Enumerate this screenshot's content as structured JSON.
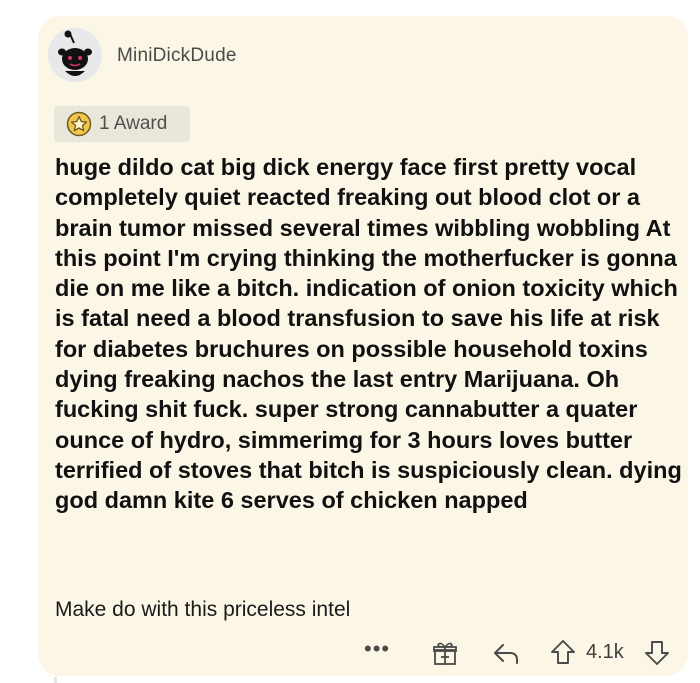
{
  "comment": {
    "username": "MiniDickDude",
    "award_label": "1 Award",
    "body": "huge dildo cat big dick energy face first pretty vocal completely quiet reacted freaking out blood clot or a brain tumor missed several times wibbling wobbling At this point I'm crying thinking the motherfucker is gonna die on me like a bitch. indication of onion toxicity which is fatal need a blood transfusion to save his life at risk for diabetes bruchures on possible household toxins dying freaking nachos the last entry Marijuana. Oh fucking shit fuck. super strong cannabutter a quater ounce of hydro, simmerimg for 3 hours loves butter terrified of stoves that bitch is suspiciously clean. dying god damn kite 6 serves of chicken napped",
    "footer": "Make do with this priceless intel",
    "more_label": "•••",
    "vote_count": "4.1k"
  },
  "icons": {
    "avatar": "snoo-avatar-icon",
    "award": "award-star-icon",
    "gift": "gift-icon",
    "reply": "reply-icon",
    "upvote": "upvote-arrow-icon",
    "downvote": "downvote-arrow-icon"
  },
  "colors": {
    "card_background": "#fbf6e5",
    "award_background": "#e9e6da",
    "text": "#111111"
  }
}
